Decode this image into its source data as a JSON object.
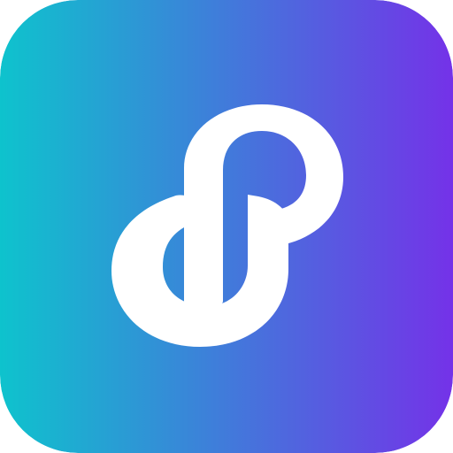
{
  "icon": {
    "name": "link-logo-icon",
    "colors": {
      "gradient_start": "#0EC3CD",
      "gradient_end": "#7432E8",
      "glyph": "#FFFFFF"
    }
  }
}
